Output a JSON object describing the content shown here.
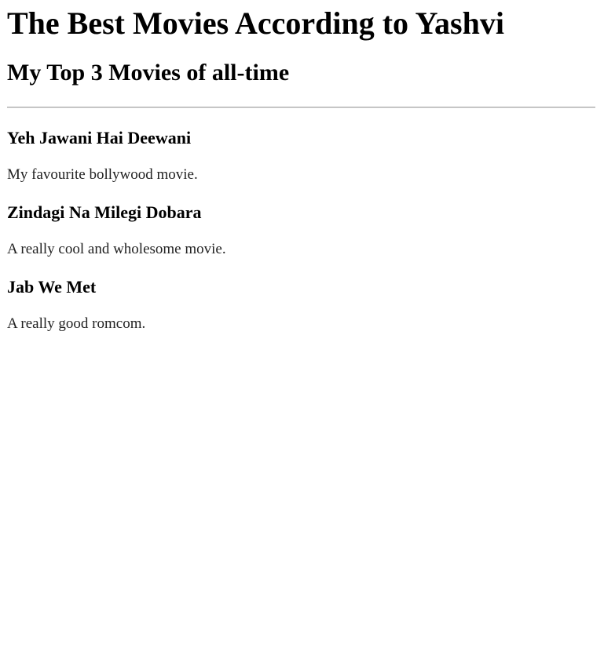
{
  "header": {
    "title": "The Best Movies According to Yashvi",
    "subtitle": "My Top 3 Movies of all-time"
  },
  "movies": [
    {
      "title": "Yeh Jawani Hai Deewani",
      "description": "My favourite bollywood movie."
    },
    {
      "title": "Zindagi Na Milegi Dobara",
      "description": "A really cool and wholesome movie."
    },
    {
      "title": "Jab We Met",
      "description": "A really good romcom."
    }
  ],
  "colors": {
    "background": "#ffffff",
    "text": "#000000",
    "divider": "#9a9a9a"
  }
}
